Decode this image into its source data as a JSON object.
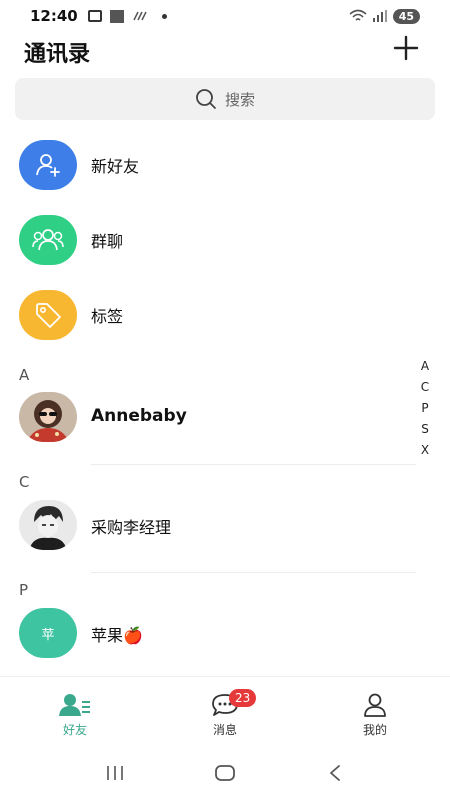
{
  "status_bar": {
    "time": "12:40",
    "battery": "45"
  },
  "header": {
    "title": "通讯录"
  },
  "search": {
    "placeholder": "搜索"
  },
  "features": [
    {
      "label": "新好友",
      "color": "#3d7ee8"
    },
    {
      "label": "群聊",
      "color": "#2fcf86"
    },
    {
      "label": "标签",
      "color": "#f7b731"
    }
  ],
  "sections": [
    {
      "letter": "A",
      "contacts": [
        {
          "name": "Annebaby"
        }
      ]
    },
    {
      "letter": "C",
      "contacts": [
        {
          "name": "采购李经理"
        }
      ]
    },
    {
      "letter": "P",
      "contacts": [
        {
          "name": "苹果🍎",
          "avatar_text": "苹"
        }
      ]
    }
  ],
  "alpha_index": [
    "A",
    "C",
    "P",
    "S",
    "X"
  ],
  "bottom_nav": {
    "items": [
      {
        "label": "好友",
        "active": true
      },
      {
        "label": "消息",
        "badge": "23"
      },
      {
        "label": "我的"
      }
    ]
  },
  "colors": {
    "accent": "#3aa88d",
    "badge": "#e63a3a"
  }
}
